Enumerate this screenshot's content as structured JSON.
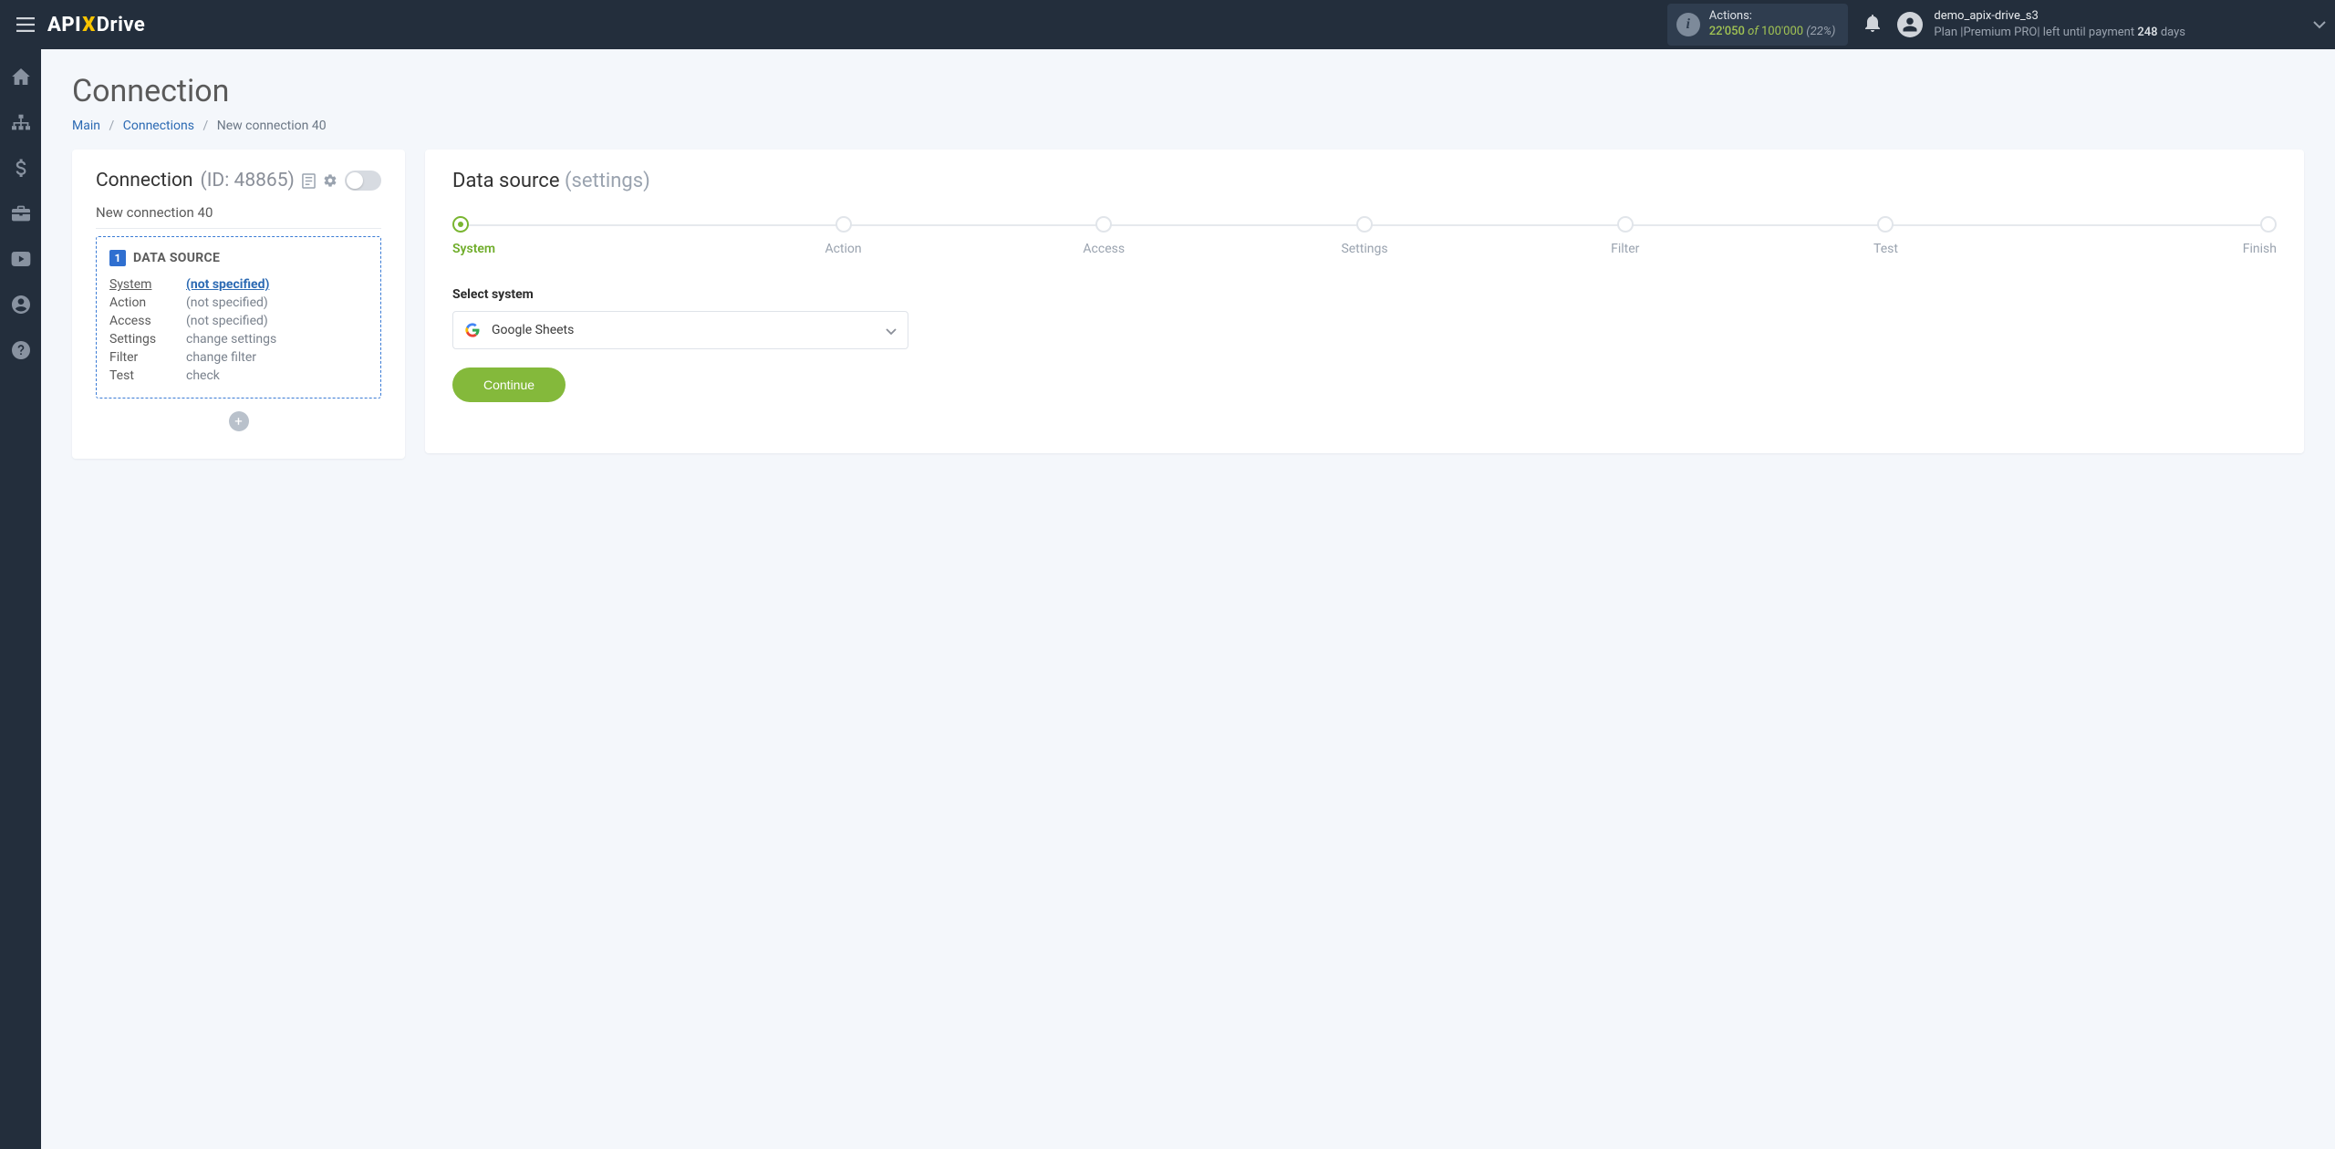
{
  "header": {
    "logo_api": "API",
    "logo_x": "X",
    "logo_drive": "Drive",
    "actions_label": "Actions:",
    "actions_used": "22'050",
    "actions_of": "of",
    "actions_total": "100'000",
    "actions_pct": "(22%)",
    "account_name": "demo_apix-drive_s3",
    "plan_prefix": "Plan |",
    "plan_name": "Premium PRO",
    "plan_mid": "| left until payment ",
    "plan_days": "248",
    "plan_suffix": " days"
  },
  "page": {
    "title": "Connection",
    "breadcrumb_main": "Main",
    "breadcrumb_connections": "Connections",
    "breadcrumb_current": "New connection 40"
  },
  "left": {
    "conn_label": "Connection",
    "conn_id_prefix": "(ID: ",
    "conn_id": "48865",
    "conn_id_suffix": ")",
    "conn_subtitle": "New connection 40",
    "ds_badge": "1",
    "ds_title": "DATA SOURCE",
    "rows": {
      "system_k": "System",
      "system_v": "(not specified)",
      "action_k": "Action",
      "action_v": "(not specified)",
      "access_k": "Access",
      "access_v": "(not specified)",
      "settings_k": "Settings",
      "settings_v": "change settings",
      "filter_k": "Filter",
      "filter_v": "change filter",
      "test_k": "Test",
      "test_v": "check"
    }
  },
  "right": {
    "heading_main": "Data source",
    "heading_muted": "(settings)",
    "steps": [
      "System",
      "Action",
      "Access",
      "Settings",
      "Filter",
      "Test",
      "Finish"
    ],
    "active_step": 0,
    "field_label": "Select system",
    "select_value": "Google Sheets",
    "continue_label": "Continue"
  }
}
